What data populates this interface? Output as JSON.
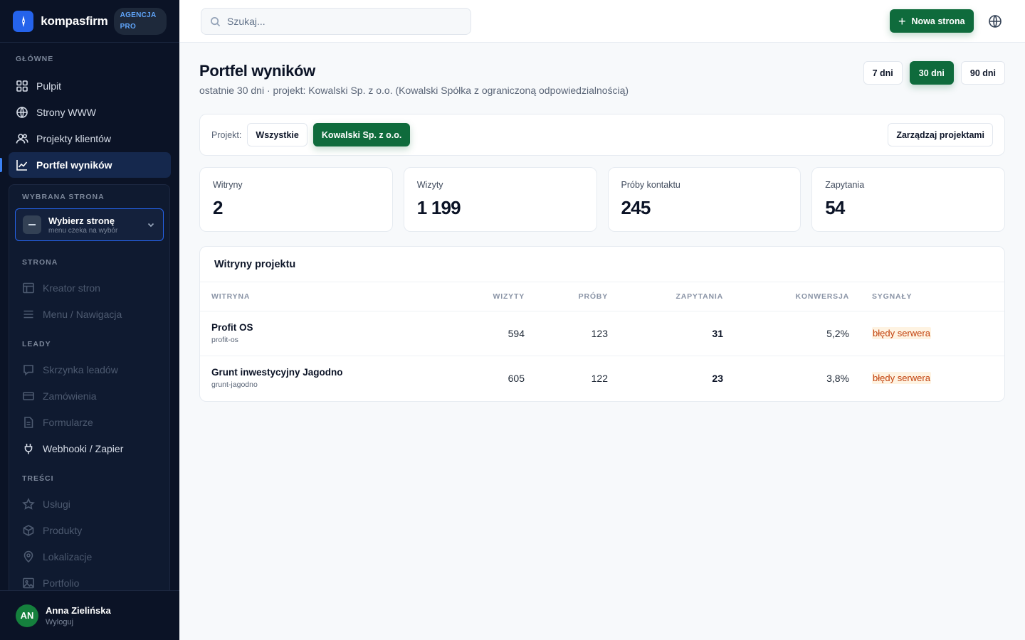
{
  "brand": {
    "name": "kompasfirm",
    "badge": "AGENCJA PRO"
  },
  "sidebar": {
    "main_label": "GŁÓWNE",
    "main_items": [
      {
        "label": "Pulpit",
        "icon": "grid-icon"
      },
      {
        "label": "Strony WWW",
        "icon": "globe-icon"
      },
      {
        "label": "Projekty klientów",
        "icon": "users-icon"
      },
      {
        "label": "Portfel wyników",
        "icon": "chart-line-icon",
        "active": true
      }
    ],
    "panel": {
      "selected_label": "WYBRANA STRONA",
      "select_title": "Wybierz stronę",
      "select_sub": "menu czeka na wybór",
      "strona_label": "STRONA",
      "strona_items": [
        "Kreator stron",
        "Menu / Nawigacja"
      ],
      "leady_label": "LEADY",
      "leady_items": [
        "Skrzynka leadów",
        "Zamówienia",
        "Formularze",
        "Webhooki / Zapier"
      ],
      "tresci_label": "TREŚCI",
      "tresci_items": [
        "Usługi",
        "Produkty",
        "Lokalizacje",
        "Portfolio"
      ]
    },
    "user": {
      "initials": "AN",
      "name": "Anna Zielińska",
      "logout": "Wyloguj"
    }
  },
  "topbar": {
    "search_placeholder": "Szukaj...",
    "new_button": "Nowa strona"
  },
  "main": {
    "title": "Portfel wyników",
    "subtitle": "ostatnie 30 dni · projekt: Kowalski Sp. z o.o. (Kowalski Spółka z ograniczoną odpowiedzialnością)",
    "ranges": [
      {
        "label": "7 dni",
        "active": false
      },
      {
        "label": "30 dni",
        "active": true
      },
      {
        "label": "90 dni",
        "active": false
      }
    ],
    "filter": {
      "label": "Projekt:",
      "chips": [
        {
          "label": "Wszystkie",
          "active": false
        },
        {
          "label": "Kowalski Sp. z o.o.",
          "active": true
        }
      ],
      "manage": "Zarządzaj projektami"
    },
    "stats": [
      {
        "label": "Witryny",
        "value": "2"
      },
      {
        "label": "Wizyty",
        "value": "1 199"
      },
      {
        "label": "Próby kontaktu",
        "value": "245"
      },
      {
        "label": "Zapytania",
        "value": "54"
      }
    ],
    "table": {
      "title": "Witryny projektu",
      "columns": [
        "WITRYNA",
        "WIZYTY",
        "PRÓBY",
        "ZAPYTANIA",
        "KONWERSJA",
        "SYGNAŁY"
      ],
      "rows": [
        {
          "name": "Profit OS",
          "slug": "profit-os",
          "visits": "594",
          "attempts": "123",
          "inquiries": "31",
          "conversion": "5,2%",
          "signal": "błędy serwera"
        },
        {
          "name": "Grunt inwestycyjny Jagodno",
          "slug": "grunt-jagodno",
          "visits": "605",
          "attempts": "122",
          "inquiries": "23",
          "conversion": "3,8%",
          "signal": "błędy serwera"
        }
      ]
    }
  },
  "colors": {
    "accent_green": "#0f6b3c",
    "sidebar_bg": "#0b1326",
    "brand_blue": "#2563eb",
    "signal_bg": "#fef3e2",
    "signal_text": "#c2410c"
  }
}
